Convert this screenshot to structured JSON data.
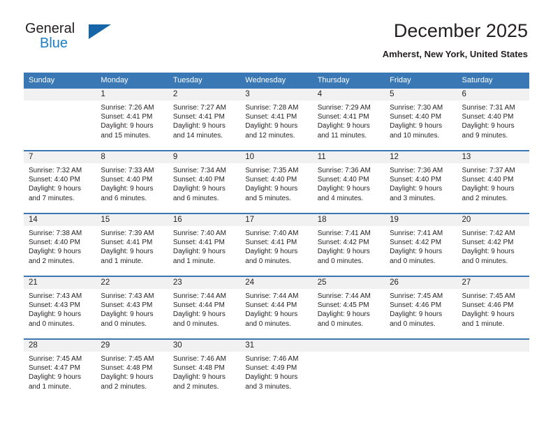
{
  "logo": {
    "word_top": "General",
    "word_bottom": "Blue",
    "accent_color": "#1c7fc4",
    "triangle_color": "#1565a8"
  },
  "header": {
    "title": "December 2025",
    "subtitle": "Amherst, New York, United States"
  },
  "theme": {
    "header_blue": "#3a78b5",
    "band_gray": "#f1f1f1",
    "text": "#231f20"
  },
  "weekdays": [
    "Sunday",
    "Monday",
    "Tuesday",
    "Wednesday",
    "Thursday",
    "Friday",
    "Saturday"
  ],
  "weeks": [
    [
      {
        "day": "",
        "lines": []
      },
      {
        "day": "1",
        "lines": [
          "Sunrise: 7:26 AM",
          "Sunset: 4:41 PM",
          "Daylight: 9 hours",
          "and 15 minutes."
        ]
      },
      {
        "day": "2",
        "lines": [
          "Sunrise: 7:27 AM",
          "Sunset: 4:41 PM",
          "Daylight: 9 hours",
          "and 14 minutes."
        ]
      },
      {
        "day": "3",
        "lines": [
          "Sunrise: 7:28 AM",
          "Sunset: 4:41 PM",
          "Daylight: 9 hours",
          "and 12 minutes."
        ]
      },
      {
        "day": "4",
        "lines": [
          "Sunrise: 7:29 AM",
          "Sunset: 4:41 PM",
          "Daylight: 9 hours",
          "and 11 minutes."
        ]
      },
      {
        "day": "5",
        "lines": [
          "Sunrise: 7:30 AM",
          "Sunset: 4:40 PM",
          "Daylight: 9 hours",
          "and 10 minutes."
        ]
      },
      {
        "day": "6",
        "lines": [
          "Sunrise: 7:31 AM",
          "Sunset: 4:40 PM",
          "Daylight: 9 hours",
          "and 9 minutes."
        ]
      }
    ],
    [
      {
        "day": "7",
        "lines": [
          "Sunrise: 7:32 AM",
          "Sunset: 4:40 PM",
          "Daylight: 9 hours",
          "and 7 minutes."
        ]
      },
      {
        "day": "8",
        "lines": [
          "Sunrise: 7:33 AM",
          "Sunset: 4:40 PM",
          "Daylight: 9 hours",
          "and 6 minutes."
        ]
      },
      {
        "day": "9",
        "lines": [
          "Sunrise: 7:34 AM",
          "Sunset: 4:40 PM",
          "Daylight: 9 hours",
          "and 6 minutes."
        ]
      },
      {
        "day": "10",
        "lines": [
          "Sunrise: 7:35 AM",
          "Sunset: 4:40 PM",
          "Daylight: 9 hours",
          "and 5 minutes."
        ]
      },
      {
        "day": "11",
        "lines": [
          "Sunrise: 7:36 AM",
          "Sunset: 4:40 PM",
          "Daylight: 9 hours",
          "and 4 minutes."
        ]
      },
      {
        "day": "12",
        "lines": [
          "Sunrise: 7:36 AM",
          "Sunset: 4:40 PM",
          "Daylight: 9 hours",
          "and 3 minutes."
        ]
      },
      {
        "day": "13",
        "lines": [
          "Sunrise: 7:37 AM",
          "Sunset: 4:40 PM",
          "Daylight: 9 hours",
          "and 2 minutes."
        ]
      }
    ],
    [
      {
        "day": "14",
        "lines": [
          "Sunrise: 7:38 AM",
          "Sunset: 4:40 PM",
          "Daylight: 9 hours",
          "and 2 minutes."
        ]
      },
      {
        "day": "15",
        "lines": [
          "Sunrise: 7:39 AM",
          "Sunset: 4:41 PM",
          "Daylight: 9 hours",
          "and 1 minute."
        ]
      },
      {
        "day": "16",
        "lines": [
          "Sunrise: 7:40 AM",
          "Sunset: 4:41 PM",
          "Daylight: 9 hours",
          "and 1 minute."
        ]
      },
      {
        "day": "17",
        "lines": [
          "Sunrise: 7:40 AM",
          "Sunset: 4:41 PM",
          "Daylight: 9 hours",
          "and 0 minutes."
        ]
      },
      {
        "day": "18",
        "lines": [
          "Sunrise: 7:41 AM",
          "Sunset: 4:42 PM",
          "Daylight: 9 hours",
          "and 0 minutes."
        ]
      },
      {
        "day": "19",
        "lines": [
          "Sunrise: 7:41 AM",
          "Sunset: 4:42 PM",
          "Daylight: 9 hours",
          "and 0 minutes."
        ]
      },
      {
        "day": "20",
        "lines": [
          "Sunrise: 7:42 AM",
          "Sunset: 4:42 PM",
          "Daylight: 9 hours",
          "and 0 minutes."
        ]
      }
    ],
    [
      {
        "day": "21",
        "lines": [
          "Sunrise: 7:43 AM",
          "Sunset: 4:43 PM",
          "Daylight: 9 hours",
          "and 0 minutes."
        ]
      },
      {
        "day": "22",
        "lines": [
          "Sunrise: 7:43 AM",
          "Sunset: 4:43 PM",
          "Daylight: 9 hours",
          "and 0 minutes."
        ]
      },
      {
        "day": "23",
        "lines": [
          "Sunrise: 7:44 AM",
          "Sunset: 4:44 PM",
          "Daylight: 9 hours",
          "and 0 minutes."
        ]
      },
      {
        "day": "24",
        "lines": [
          "Sunrise: 7:44 AM",
          "Sunset: 4:44 PM",
          "Daylight: 9 hours",
          "and 0 minutes."
        ]
      },
      {
        "day": "25",
        "lines": [
          "Sunrise: 7:44 AM",
          "Sunset: 4:45 PM",
          "Daylight: 9 hours",
          "and 0 minutes."
        ]
      },
      {
        "day": "26",
        "lines": [
          "Sunrise: 7:45 AM",
          "Sunset: 4:46 PM",
          "Daylight: 9 hours",
          "and 0 minutes."
        ]
      },
      {
        "day": "27",
        "lines": [
          "Sunrise: 7:45 AM",
          "Sunset: 4:46 PM",
          "Daylight: 9 hours",
          "and 1 minute."
        ]
      }
    ],
    [
      {
        "day": "28",
        "lines": [
          "Sunrise: 7:45 AM",
          "Sunset: 4:47 PM",
          "Daylight: 9 hours",
          "and 1 minute."
        ]
      },
      {
        "day": "29",
        "lines": [
          "Sunrise: 7:45 AM",
          "Sunset: 4:48 PM",
          "Daylight: 9 hours",
          "and 2 minutes."
        ]
      },
      {
        "day": "30",
        "lines": [
          "Sunrise: 7:46 AM",
          "Sunset: 4:48 PM",
          "Daylight: 9 hours",
          "and 2 minutes."
        ]
      },
      {
        "day": "31",
        "lines": [
          "Sunrise: 7:46 AM",
          "Sunset: 4:49 PM",
          "Daylight: 9 hours",
          "and 3 minutes."
        ]
      },
      {
        "day": "",
        "lines": []
      },
      {
        "day": "",
        "lines": []
      },
      {
        "day": "",
        "lines": []
      }
    ]
  ]
}
